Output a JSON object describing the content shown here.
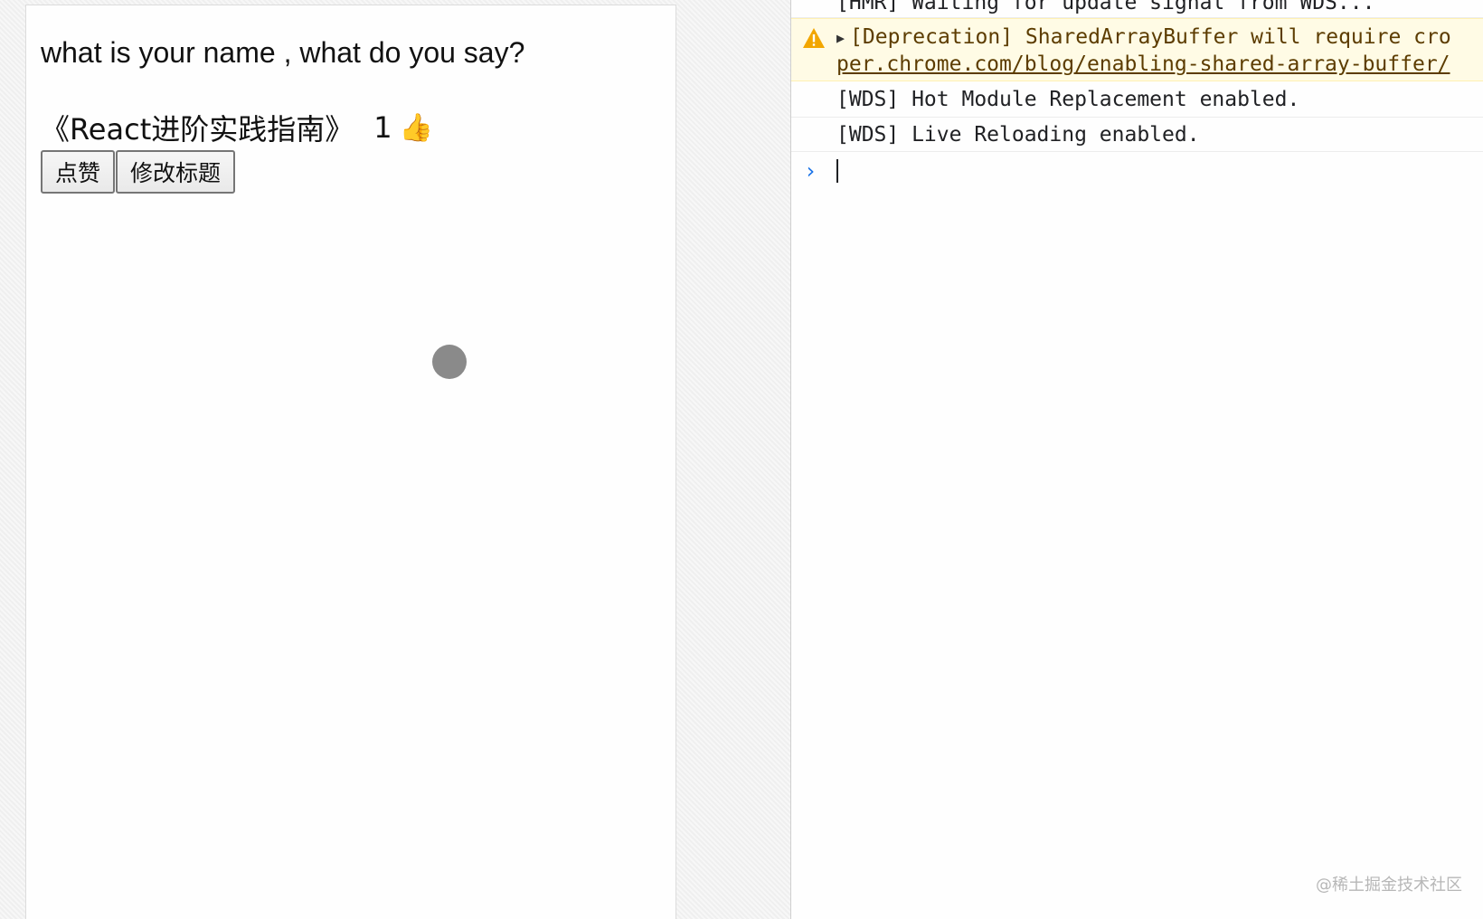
{
  "app": {
    "question": "what is your name , what do you say?",
    "book_title": "《React进阶实践指南》",
    "like_count": "1",
    "like_emoji": "👍",
    "buttons": {
      "like_label": "点赞",
      "edit_title_label": "修改标题"
    }
  },
  "console": {
    "messages": [
      {
        "type": "log",
        "text": "[HMR] Waiting for update signal from WDS..."
      },
      {
        "type": "warning",
        "text": "[Deprecation] SharedArrayBuffer will require cro",
        "link": "per.chrome.com/blog/enabling-shared-array-buffer/"
      },
      {
        "type": "log",
        "text": "[WDS] Hot Module Replacement enabled."
      },
      {
        "type": "log",
        "text": "[WDS] Live Reloading enabled."
      }
    ],
    "prompt_symbol": "›",
    "colors": {
      "warning_bg": "#fffbe5",
      "warning_text": "#5c3c00",
      "prompt": "#1a73e8"
    }
  },
  "watermark": "@稀土掘金技术社区",
  "icons": {
    "warning": "warning-triangle-icon",
    "expand": "expand-triangle-icon",
    "prompt": "chevron-right-icon"
  }
}
